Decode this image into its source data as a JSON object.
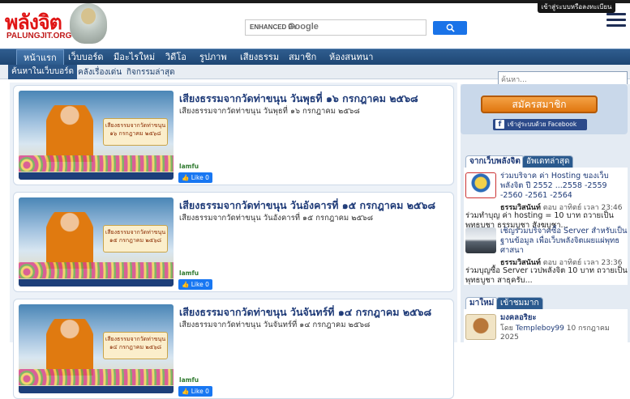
{
  "header": {
    "brand": "พลังจิต",
    "brand_sub": "PALUNGJIT.ORG",
    "search_label": "ENHANCED BY",
    "search_google": "Google",
    "search_button_icon": "search-icon",
    "login_label": "เข้าสู่ระบบหรือลงทะเบียน",
    "menu_icon": "hamburger-icon"
  },
  "nav": {
    "items": [
      "หน้าแรก",
      "เว็บบอร์ด",
      "มีอะไรใหม่",
      "วิดีโอ",
      "รูปภาพ",
      "เสียงธรรม",
      "สมาชิก",
      "ห้องสนทนา"
    ],
    "active_index": 0
  },
  "subnav": {
    "items": [
      "ค้นหาในเว็บบอร์ด",
      "คลังเรื่องเด่น",
      "กิจกรรมล่าสุด"
    ]
  },
  "site_search": {
    "placeholder": "ค้นหา..."
  },
  "cards": [
    {
      "title": "เสียงธรรมจากวัดท่าขนุน วันพุธที่ ๑๖ กรกฎาคม ๒๕๖๘",
      "subtitle": "เสียงธรรมจากวัดท่าขนุน วันพุธที่ ๑๖ กรกฎาคม ๒๕๖๘",
      "thumb_text_line1": "เสียงธรรมจากวัดท่าขนุน",
      "thumb_text_line2": "๑๖ กรกฎาคม ๒๕๖๘",
      "author": "lamfu",
      "like": "Like 0"
    },
    {
      "title": "เสียงธรรมจากวัดท่าขนุน วันอังคารที่ ๑๕ กรกฎาคม ๒๕๖๘",
      "subtitle": "เสียงธรรมจากวัดท่าขนุน วันอังคารที่ ๑๕ กรกฎาคม ๒๕๖๘",
      "thumb_text_line1": "เสียงธรรมจากวัดท่าขนุน",
      "thumb_text_line2": "๑๕ กรกฎาคม ๒๕๖๘",
      "author": "lamfu",
      "like": "Like 0"
    },
    {
      "title": "เสียงธรรมจากวัดท่าขนุน วันจันทร์ที่ ๑๔ กรกฎาคม ๒๕๖๘",
      "subtitle": "เสียงธรรมจากวัดท่าขนุน วันจันทร์ที่ ๑๔ กรกฎาคม ๒๕๖๘",
      "thumb_text_line1": "เสียงธรรมจากวัดท่าขนุน",
      "thumb_text_line2": "๑๔ กรกฎาคม ๒๕๖๘",
      "author": "lamfu",
      "like": "Like 0"
    }
  ],
  "sidebar": {
    "join_button": "สมัครสมาชิก",
    "facebook_button": "เข้าสู่ระบบด้วย Facebook",
    "tabs": [
      "จากเว็บพลังจิต",
      "อัพเดทล่าสุด"
    ],
    "posts": [
      {
        "title": "ร่วมบริจาค ค่า Hosting ของเว็บพลังจิต ปี 2552 ...2558 -2559 -2560 -2561 -2564",
        "author": "ธรรมวิสนันท์",
        "time": "ตอบ อาทิตย์ เวลา 23:46",
        "excerpt": "ร่วมทำบุญ ค่า hosting = 10 บาท ถวายเป็นพุทธบูชา ธรรมบูชา สังฆบูชา..."
      },
      {
        "title": "เชิญร่วมบริจาคซื้อ Server สำหรับเป็นฐานข้อมูล เพื่อเว็บพลังจิตเผยแผ่พุทธศาสนา",
        "author": "ธรรมวิสนันท์",
        "time": "ตอบ อาทิตย์ เวลา 23:36",
        "excerpt": "ร่วมบุญซื้อ Server เวปพลังจิต 10 บาท ถวายเป็นพุทธบูชา สาธุครับ..."
      }
    ],
    "tabs2": [
      "มาใหม่",
      "เข้าชมมาก"
    ],
    "latest": {
      "title": "มงคลอริยะ",
      "by": "โดย",
      "author": "Templeboy99",
      "date": "10 กรกฎาคม 2025"
    }
  },
  "colors": {
    "brand_red": "#e01515",
    "nav_blue": "#1e4673",
    "title_blue": "#1f3b78",
    "join_orange": "#e0760f",
    "facebook_blue": "#1877f2"
  }
}
